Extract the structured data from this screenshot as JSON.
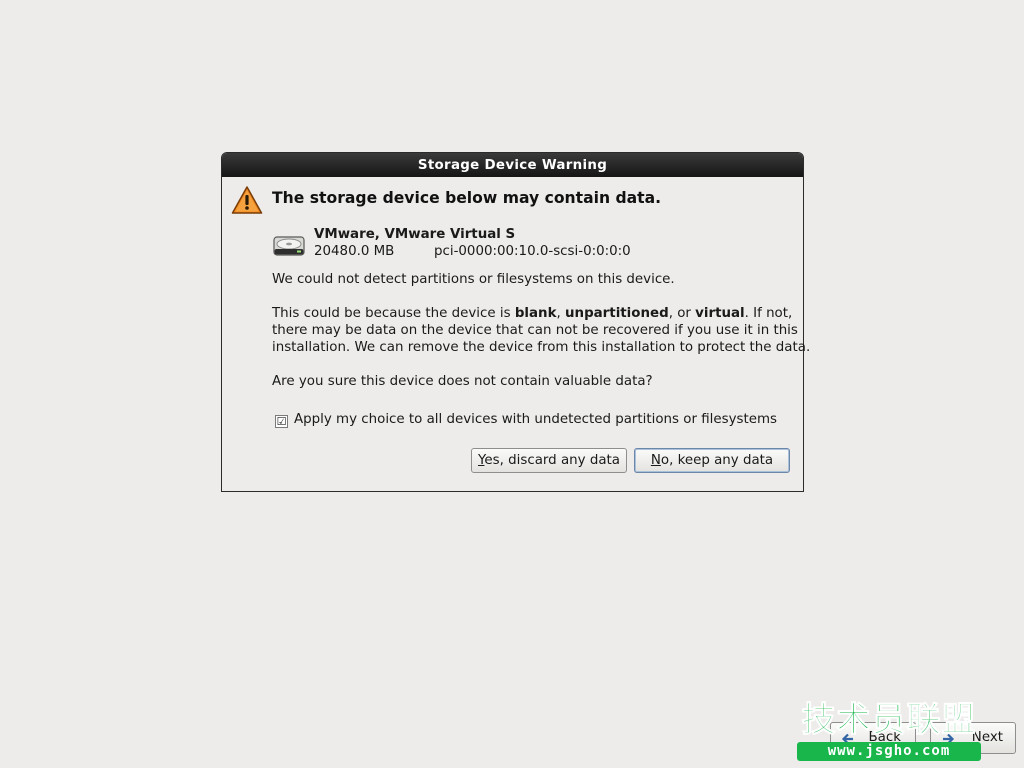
{
  "dialog": {
    "title": "Storage Device Warning",
    "headline": "The storage device below may contain data.",
    "device": {
      "name": "VMware, VMware Virtual S",
      "size": "20480.0 MB",
      "path": "pci-0000:00:10.0-scsi-0:0:0:0"
    },
    "paragraph1": "We could not detect partitions or filesystems on this device.",
    "paragraph2": {
      "part1": "This could be because the device is ",
      "blank": "blank",
      "sep1": ", ",
      "unpartitioned": "unpartitioned",
      "sep2": ", or ",
      "virtual": "virtual",
      "part2": ". If not,",
      "line2": "there may be data on the device that can not be recovered if you use it in this",
      "line3": "installation. We can remove the device from this installation to protect the data."
    },
    "question": "Are you sure this device does not contain valuable data?",
    "checkbox": {
      "checked": true,
      "mark": "☑",
      "label": "Apply my choice to all devices with undetected partitions or filesystems"
    },
    "buttons": {
      "yes_mnemonic": "Y",
      "yes_rest": "es, discard any data",
      "no_mnemonic": "N",
      "no_rest": "o, keep any data"
    }
  },
  "nav": {
    "back_label": "Back",
    "next_label": "Next"
  },
  "watermark": {
    "text": "技术员联盟",
    "url": "www.jsgho.com"
  },
  "colors": {
    "background": "#edecea",
    "titlebar": "#1e1e1e",
    "warning_orange": "#f08a24",
    "watermark_green": "#18b64b"
  },
  "icons": {
    "warning": "warning-icon",
    "disk": "hard-disk-icon",
    "back": "back-arrow-icon",
    "next": "next-arrow-icon"
  }
}
